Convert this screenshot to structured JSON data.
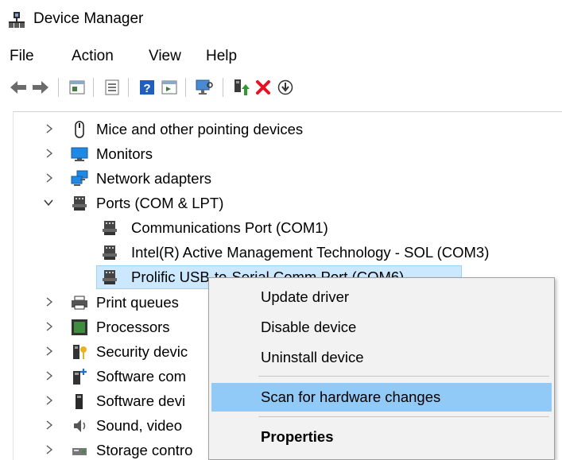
{
  "window": {
    "title": "Device Manager",
    "icon": "device-manager-icon"
  },
  "menu": {
    "items": [
      "File",
      "Action",
      "View",
      "Help"
    ]
  },
  "toolbar": {
    "buttons": [
      "back-arrow-icon",
      "forward-arrow-icon",
      "show-hide-tree-icon",
      "properties-icon",
      "help-icon",
      "run-action-icon",
      "scan-monitor-icon",
      "update-driver-icon",
      "uninstall-x-icon",
      "disable-download-icon"
    ]
  },
  "tree": {
    "items": [
      {
        "label": "Mice and other pointing devices",
        "icon": "mouse-icon",
        "expanded": false
      },
      {
        "label": "Monitors",
        "icon": "monitor-icon",
        "expanded": false
      },
      {
        "label": "Network adapters",
        "icon": "network-adapter-icon",
        "expanded": false
      },
      {
        "label": "Ports (COM & LPT)",
        "icon": "port-icon",
        "expanded": true
      },
      {
        "label": "Communications Port (COM1)",
        "icon": "port-icon",
        "child": true
      },
      {
        "label": "Intel(R) Active Management Technology - SOL (COM3)",
        "icon": "port-icon",
        "child": true
      },
      {
        "label": "Prolific USB-to-Serial Comm Port (COM6)",
        "icon": "port-icon",
        "child": true,
        "selected": true
      },
      {
        "label": "Print queues",
        "icon": "printer-icon",
        "expanded": false
      },
      {
        "label": "Processors",
        "icon": "processor-icon",
        "expanded": false
      },
      {
        "label": "Security devic",
        "icon": "security-device-icon",
        "expanded": false
      },
      {
        "label": "Software com",
        "icon": "software-component-icon",
        "expanded": false
      },
      {
        "label": "Software devi",
        "icon": "software-device-icon",
        "expanded": false
      },
      {
        "label": "Sound, video",
        "icon": "sound-icon",
        "expanded": false
      },
      {
        "label": "Storage contro",
        "icon": "storage-icon",
        "expanded": false
      }
    ]
  },
  "context_menu": {
    "items": [
      {
        "label": "Update driver"
      },
      {
        "label": "Disable device"
      },
      {
        "label": "Uninstall device"
      },
      {
        "label": "Scan for hardware changes",
        "highlighted": true
      },
      {
        "label": "Properties",
        "bold": true
      }
    ]
  },
  "colors": {
    "selection": "#cce8ff",
    "menu_highlight": "#91c9f7",
    "menu_bg": "#f2f2f2",
    "uninstall_red": "#e81123"
  }
}
